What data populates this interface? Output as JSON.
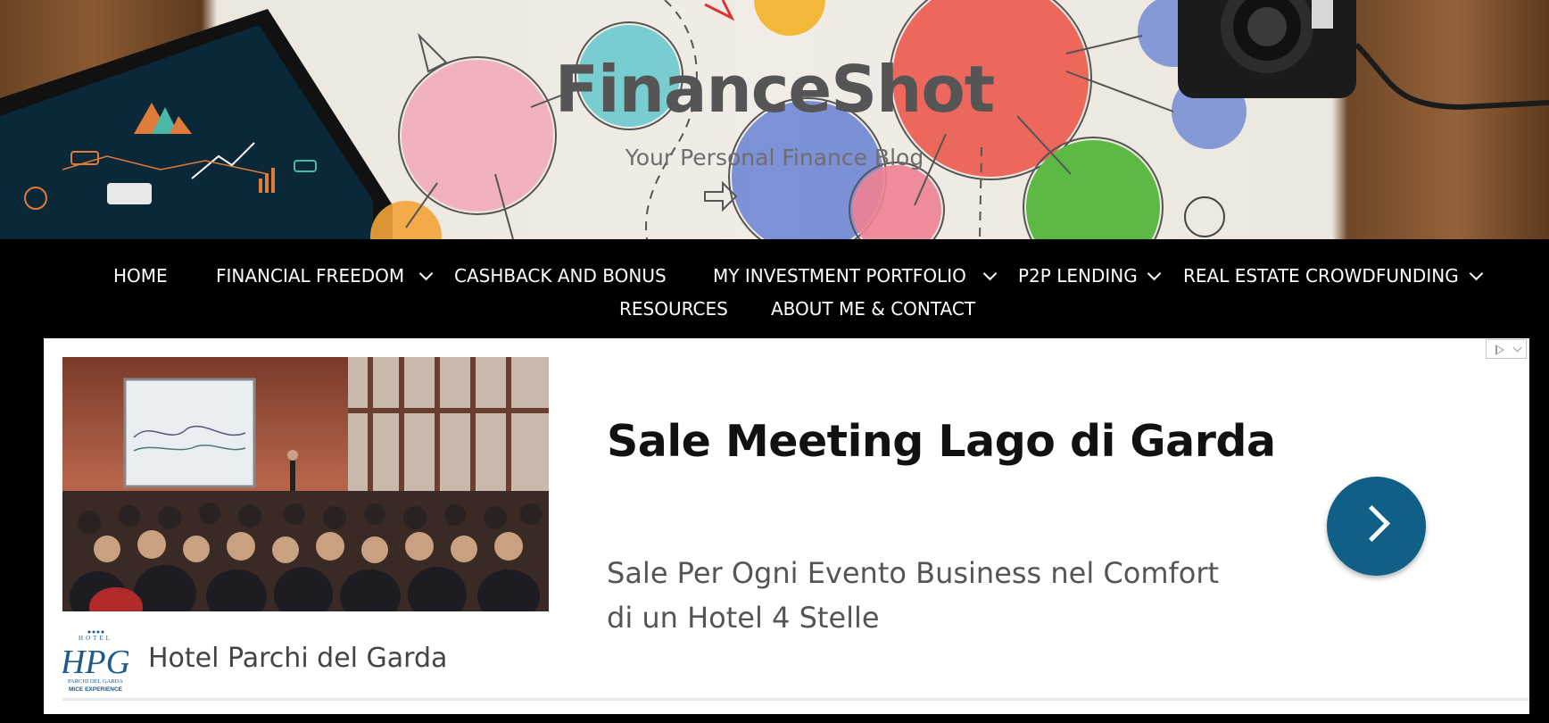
{
  "header": {
    "site_title": "FinanceShot",
    "tagline": "Your Personal Finance Blog"
  },
  "nav": {
    "items": [
      {
        "label": "HOME",
        "has_dropdown": false
      },
      {
        "label": "FINANCIAL FREEDOM",
        "has_dropdown": true
      },
      {
        "label": "CASHBACK AND BONUS",
        "has_dropdown": false
      },
      {
        "label": "MY INVESTMENT PORTFOLIO",
        "has_dropdown": true
      },
      {
        "label": "P2P LENDING",
        "has_dropdown": true
      },
      {
        "label": "REAL ESTATE CROWDFUNDING",
        "has_dropdown": true
      },
      {
        "label": "RESOURCES",
        "has_dropdown": false
      },
      {
        "label": "ABOUT ME & CONTACT",
        "has_dropdown": false
      }
    ]
  },
  "ad": {
    "headline": "Sale Meeting Lago di Garda",
    "description": "Sale Per Ogni Evento Business nel Comfort di un Hotel 4 Stelle",
    "advertiser": "Hotel Parchi del Garda",
    "cta_icon": "chevron-right-icon",
    "adchoices_icon": "adchoices-icon",
    "logo_text": "HPG",
    "logo_small_top": "HOTEL",
    "logo_small_line1": "PARCHI DEL GARDA",
    "logo_small_line2": "MICE EXPERIENCE"
  },
  "colors": {
    "nav_bg": "#000000",
    "nav_text": "#ffffff",
    "title": "#555555",
    "cta": "#0f5f86"
  }
}
